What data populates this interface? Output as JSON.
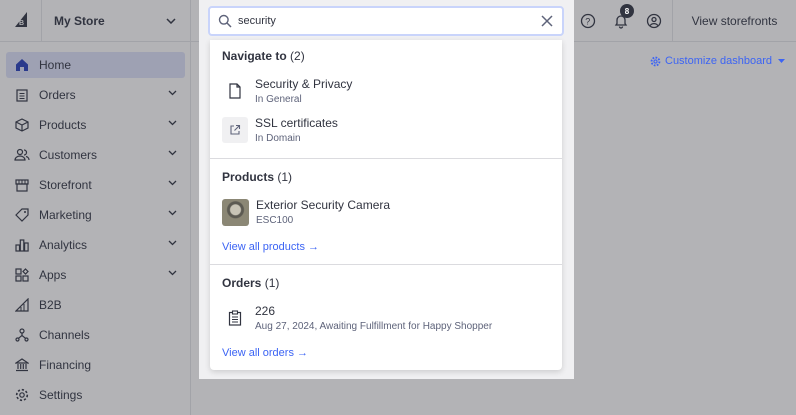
{
  "header": {
    "store_name": "My Store",
    "notifications_count": "8",
    "view_storefronts_label": "View storefronts"
  },
  "sidebar": {
    "items": [
      {
        "label": "Home",
        "icon": "home-icon",
        "active": true
      },
      {
        "label": "Orders",
        "icon": "orders-icon"
      },
      {
        "label": "Products",
        "icon": "products-icon"
      },
      {
        "label": "Customers",
        "icon": "customers-icon"
      },
      {
        "label": "Storefront",
        "icon": "storefront-icon"
      },
      {
        "label": "Marketing",
        "icon": "marketing-icon"
      },
      {
        "label": "Analytics",
        "icon": "analytics-icon"
      },
      {
        "label": "Apps",
        "icon": "apps-icon"
      },
      {
        "label": "B2B",
        "icon": "b2b-icon"
      },
      {
        "label": "Channels",
        "icon": "channels-icon"
      },
      {
        "label": "Financing",
        "icon": "financing-icon"
      },
      {
        "label": "Settings",
        "icon": "settings-icon"
      }
    ]
  },
  "main": {
    "customize_label": "Customize dashboard"
  },
  "search": {
    "value": "security",
    "navigate": {
      "title": "Navigate to",
      "count": "(2)",
      "results": [
        {
          "highlight": "Security",
          "rest": " & Privacy",
          "sub": "In General"
        },
        {
          "highlight": "",
          "rest": "SSL certificates",
          "sub": "In Domain"
        }
      ]
    },
    "products": {
      "title": "Products",
      "count": "(1)",
      "results": [
        {
          "name": "Exterior Security Camera",
          "sku": "ESC100"
        }
      ],
      "view_all": "View all products"
    },
    "orders": {
      "title": "Orders",
      "count": "(1)",
      "results": [
        {
          "id": "226",
          "sub": "Aug 27, 2024, Awaiting Fulfillment for Happy Shopper"
        }
      ],
      "view_all": "View all orders"
    }
  },
  "colors": {
    "accent": "#3c64f4",
    "text": "#313440",
    "overlay_bg": "#b3b3b6"
  }
}
